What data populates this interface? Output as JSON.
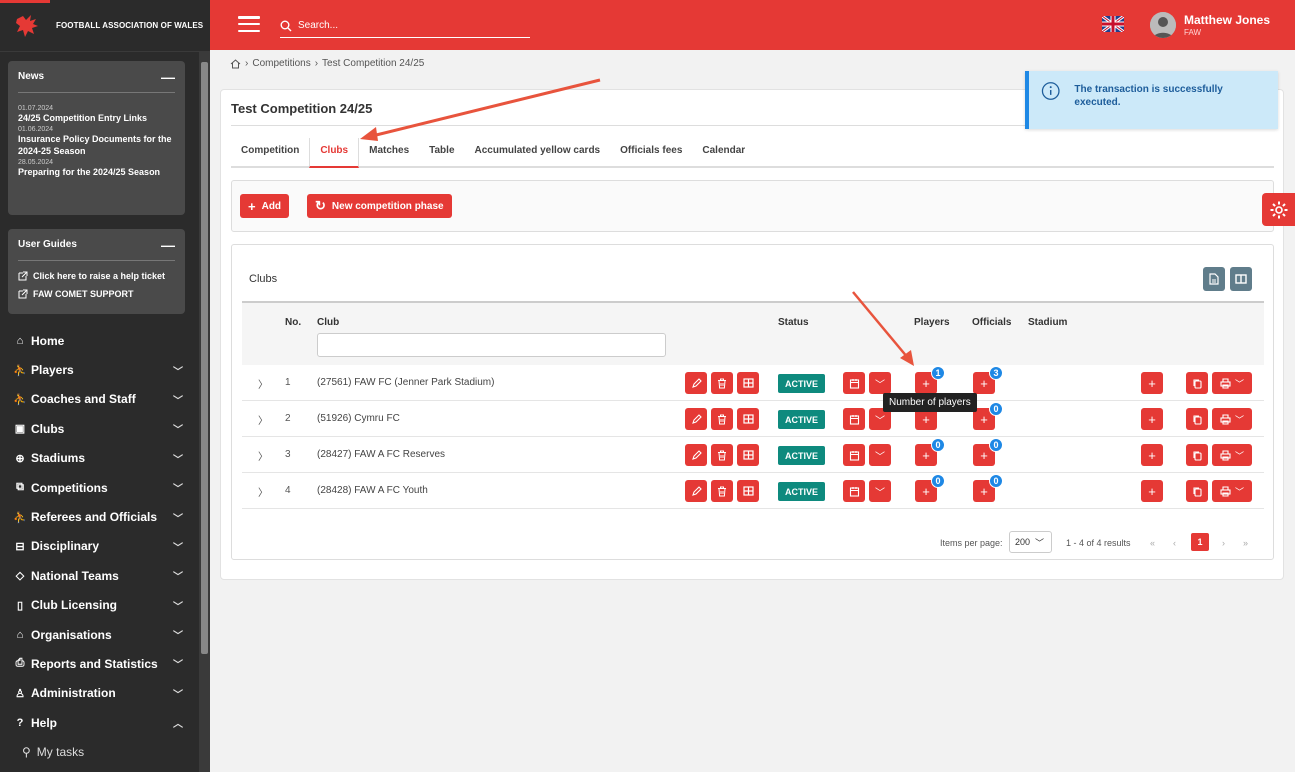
{
  "org_name": "FOOTBALL ASSOCIATION OF WALES",
  "news": {
    "title": "News",
    "items": [
      {
        "date": "01.07.2024",
        "title": "24/25 Competition Entry Links"
      },
      {
        "date": "01.06.2024",
        "title": "Insurance Policy Documents for the 2024-25 Season"
      },
      {
        "date": "28.05.2024",
        "title": "Preparing for the 2024/25 Season"
      }
    ]
  },
  "guides": {
    "title": "User Guides",
    "items": [
      "Click here to raise a help ticket",
      "FAW COMET SUPPORT"
    ]
  },
  "nav": {
    "items": [
      {
        "label": "Home",
        "icon": "home-icon"
      },
      {
        "label": "Players",
        "icon": "person-run-icon"
      },
      {
        "label": "Coaches and Staff",
        "icon": "person-run-icon"
      },
      {
        "label": "Clubs",
        "icon": "shield-icon"
      },
      {
        "label": "Stadiums",
        "icon": "globe-icon"
      },
      {
        "label": "Competitions",
        "icon": "trophy-icon"
      },
      {
        "label": "Referees and Officials",
        "icon": "person-run-icon"
      },
      {
        "label": "Disciplinary",
        "icon": "briefcase-icon"
      },
      {
        "label": "National Teams",
        "icon": "tag-icon"
      },
      {
        "label": "Club Licensing",
        "icon": "bookmark-icon"
      },
      {
        "label": "Organisations",
        "icon": "home-icon"
      },
      {
        "label": "Reports and Statistics",
        "icon": "printer-icon"
      },
      {
        "label": "Administration",
        "icon": "user-icon"
      },
      {
        "label": "Help",
        "icon": "help-icon"
      }
    ],
    "sub_item": "My tasks"
  },
  "header": {
    "search_placeholder": "Search...",
    "user_name": "Matthew Jones",
    "user_org": "FAW"
  },
  "breadcrumb": [
    "Competitions",
    "Test Competition 24/25"
  ],
  "toast": {
    "message": "The transaction is successfully executed."
  },
  "page_title": "Test Competition 24/25",
  "tabs": [
    "Competition",
    "Clubs",
    "Matches",
    "Table",
    "Accumulated yellow cards",
    "Officials fees",
    "Calendar"
  ],
  "active_tab": "Clubs",
  "toolbar": {
    "add_label": "Add",
    "new_phase_label": "New competition phase"
  },
  "clubs": {
    "title": "Clubs",
    "columns": {
      "no": "No.",
      "club": "Club",
      "status": "Status",
      "players": "Players",
      "officials": "Officials",
      "stadium": "Stadium"
    },
    "rows": [
      {
        "no": "1",
        "club": "(27561) FAW FC (Jenner Park Stadium)",
        "status": "ACTIVE",
        "players": "1",
        "officials": "3"
      },
      {
        "no": "2",
        "club": "(51926) Cymru FC",
        "status": "ACTIVE",
        "players": "",
        "officials": "0"
      },
      {
        "no": "3",
        "club": "(28427) FAW A FC Reserves",
        "status": "ACTIVE",
        "players": "0",
        "officials": "0"
      },
      {
        "no": "4",
        "club": "(28428) FAW A FC Youth",
        "status": "ACTIVE",
        "players": "0",
        "officials": "0"
      }
    ],
    "tooltip": "Number of players"
  },
  "pager": {
    "items_label": "Items per page:",
    "page_size": "200",
    "range": "1 - 4 of 4 results",
    "current": "1"
  },
  "colors": {
    "brand": "#e53935",
    "active_badge": "#0e8a7e",
    "count_badge": "#1e88e5",
    "sidebar": "#2b2b2b"
  }
}
